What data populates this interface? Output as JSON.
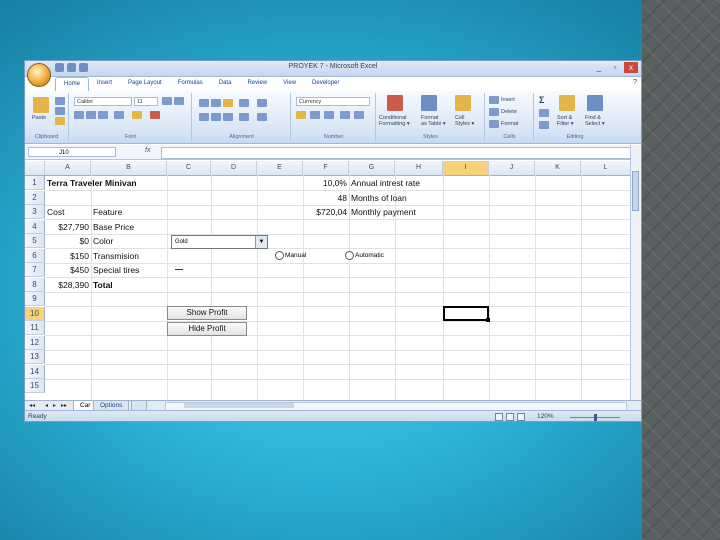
{
  "window": {
    "title": "PROYEK 7 - Microsoft Excel",
    "controls": [
      "_",
      "▫",
      "x"
    ]
  },
  "ribbon": {
    "tabs": [
      "Home",
      "Insert",
      "Page Layout",
      "Formulas",
      "Data",
      "Review",
      "View",
      "Developer"
    ],
    "font_name": "Calibri",
    "font_size": "11",
    "number_format": "Currency",
    "paste_label": "Paste",
    "groups": [
      "Clipboard",
      "Font",
      "Alignment",
      "Number",
      "Styles",
      "Cells",
      "Editing"
    ],
    "styles_buttons": {
      "conditional": "Conditional\nFormatting",
      "format_table": "Format\nas Table",
      "cell_styles": "Cell\nStyles"
    },
    "cells_buttons": {
      "insert": "Insert",
      "delete": "Delete",
      "format": "Format"
    },
    "editing_buttons": {
      "sigma": "Σ",
      "sort": "Sort &\nFilter",
      "find": "Find &\nSelect"
    }
  },
  "formula_bar": {
    "name_box": "J10",
    "fx": "fx",
    "value": ""
  },
  "grid": {
    "columns": [
      "A",
      "B",
      "C",
      "D",
      "E",
      "F",
      "G",
      "H",
      "I",
      "J",
      "K",
      "L"
    ],
    "selected_column": "I",
    "rows": [
      "1",
      "2",
      "3",
      "4",
      "5",
      "6",
      "7",
      "8",
      "9",
      "10",
      "11",
      "12",
      "13",
      "14",
      "15"
    ],
    "selected_row": "10",
    "cells": {
      "a1": "Terra Traveler Minivan",
      "a3": "Cost",
      "b3": "Feature",
      "a4": "$27,790",
      "b4": "Base Price",
      "a5": "$0",
      "b5": "Color",
      "a6": "$150",
      "b6": "Transmision",
      "a7": "$450",
      "b7": "Special tires",
      "a8": "$28,390",
      "b8": "Total",
      "f1": "10,0%",
      "g1": "Annual intrest rate",
      "f2": "48",
      "g2": "Months of loan",
      "f3": "$720,04",
      "g3": "Monthly payment"
    },
    "dropdown_value": "Gold",
    "radio_manual": "Manual",
    "radio_automatic": "Automatic",
    "buttons": {
      "show_profit": "Show Profit",
      "hide_profit": "Hide Profit"
    }
  },
  "sheets": {
    "tabs": [
      "Car",
      "Options"
    ],
    "active": "Car"
  },
  "status": {
    "ready": "Ready",
    "zoom": "120%"
  }
}
